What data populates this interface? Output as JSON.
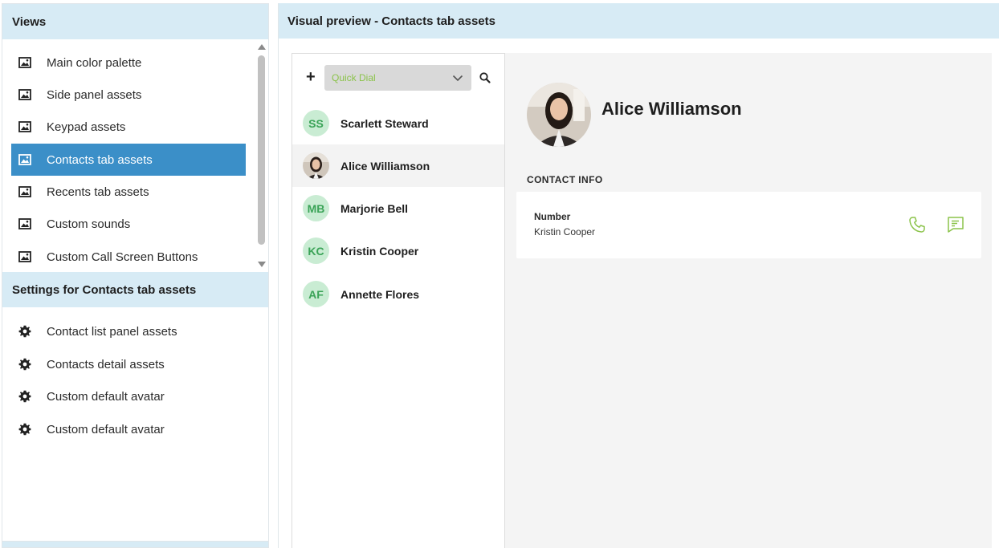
{
  "views": {
    "title": "Views",
    "items": [
      {
        "label": "Main color palette",
        "icon": "image-icon"
      },
      {
        "label": "Side panel assets",
        "icon": "image-icon"
      },
      {
        "label": "Keypad assets",
        "icon": "image-icon"
      },
      {
        "label": "Contacts tab assets",
        "icon": "image-icon",
        "selected": true
      },
      {
        "label": "Recents tab assets",
        "icon": "image-icon"
      },
      {
        "label": "Custom sounds",
        "icon": "image-icon"
      },
      {
        "label": "Custom Call Screen Buttons",
        "icon": "image-icon"
      }
    ]
  },
  "settings": {
    "title": "Settings for Contacts tab assets",
    "items": [
      {
        "label": "Contact list panel assets",
        "icon": "gear-icon"
      },
      {
        "label": "Contacts detail assets",
        "icon": "gear-icon"
      },
      {
        "label": "Custom default avatar",
        "icon": "gear-icon"
      },
      {
        "label": "Custom default avatar",
        "icon": "gear-icon"
      }
    ]
  },
  "preview": {
    "title": "Visual preview - Contacts tab assets",
    "quick_dial": "Quick Dial",
    "plus": "+",
    "contacts": [
      {
        "initials": "SS",
        "name": "Scarlett Steward"
      },
      {
        "initials": "",
        "name": "Alice Williamson",
        "photo": true,
        "active": true
      },
      {
        "initials": "MB",
        "name": "Marjorie Bell"
      },
      {
        "initials": "KC",
        "name": "Kristin Cooper"
      },
      {
        "initials": "AF",
        "name": "Annette Flores"
      }
    ],
    "detail": {
      "name": "Alice Williamson",
      "section_label": "CONTACT INFO",
      "number_label": "Number",
      "number_value": "Kristin Cooper"
    }
  },
  "colors": {
    "header_bg": "#d7ebf5",
    "selected_bg": "#3b8fc8",
    "accent_green": "#8bc34a",
    "initials_bg": "#c9ecd3",
    "initials_text": "#3aa357"
  }
}
